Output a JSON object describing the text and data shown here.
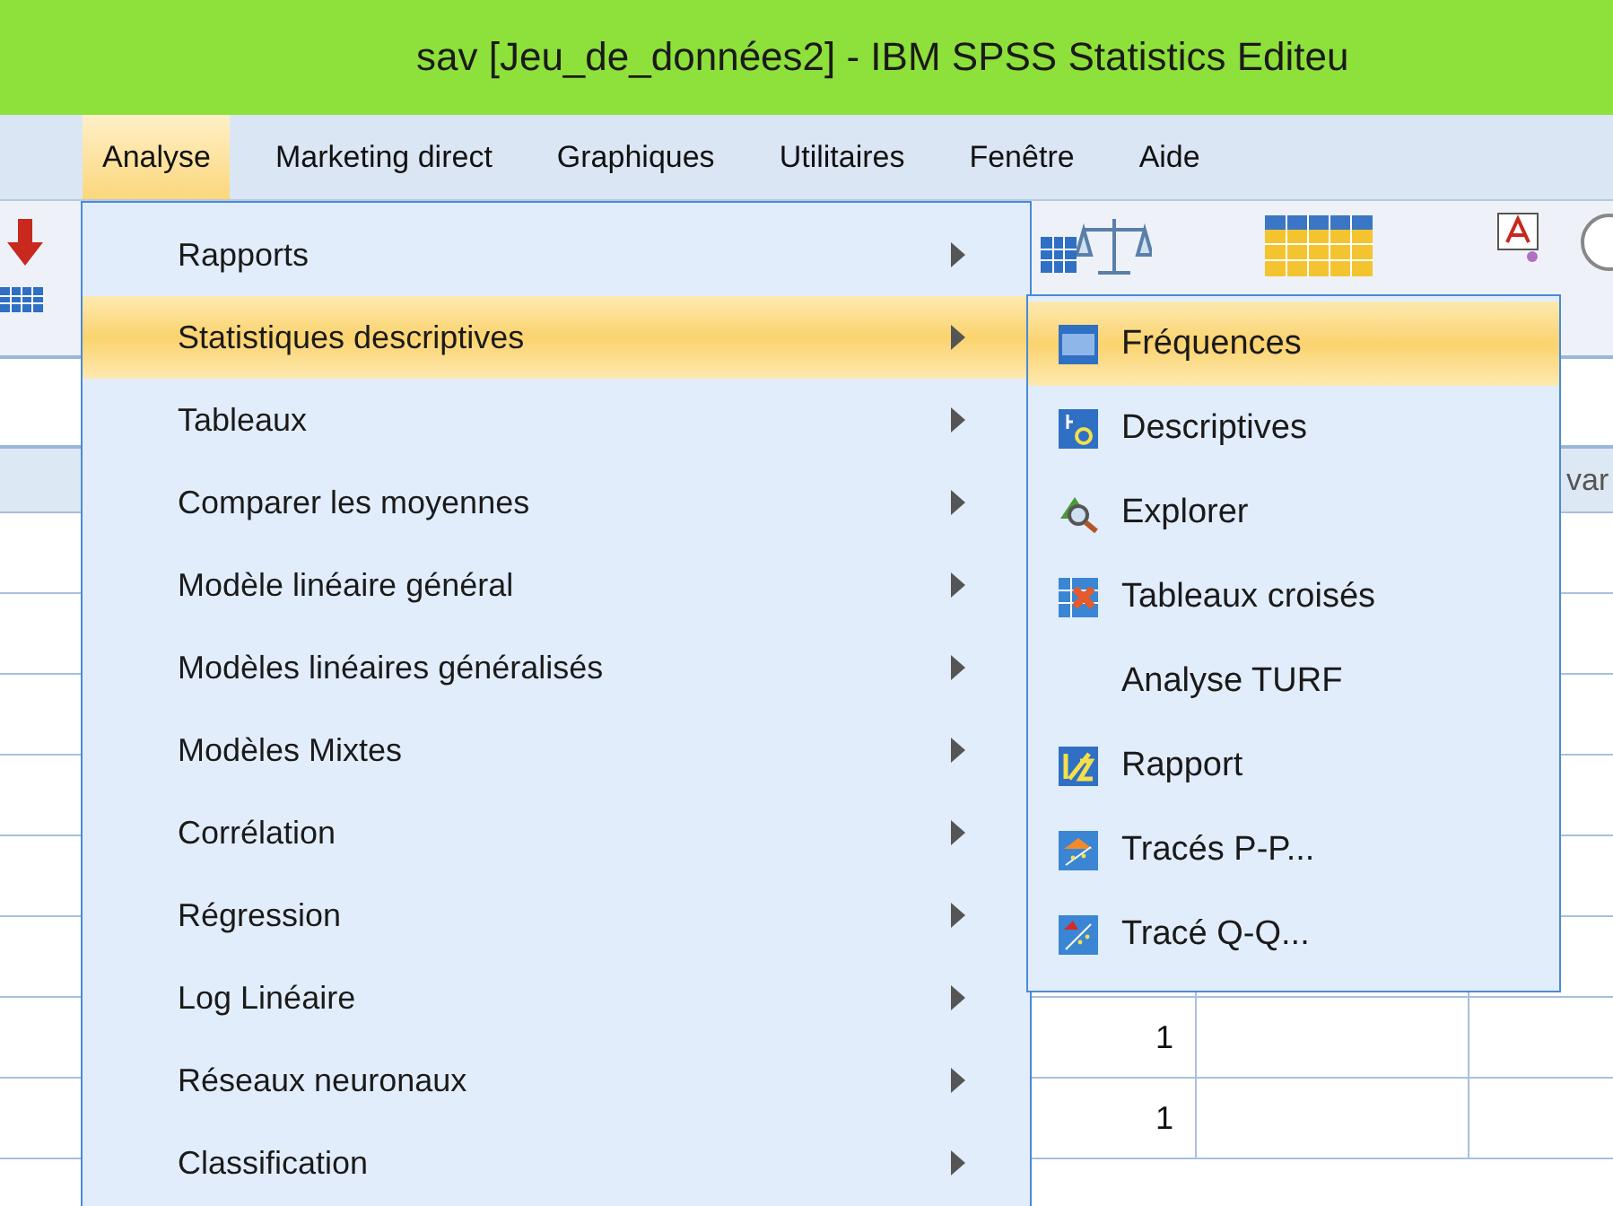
{
  "window": {
    "title": "sav [Jeu_de_données2] - IBM SPSS Statistics Editeu"
  },
  "menubar": [
    {
      "label": "Analyse",
      "selected": true
    },
    {
      "label": "Marketing direct",
      "selected": false
    },
    {
      "label": "Graphiques",
      "selected": false
    },
    {
      "label": "Utilitaires",
      "selected": false
    },
    {
      "label": "Fenêtre",
      "selected": false
    },
    {
      "label": "Aide",
      "selected": false
    }
  ],
  "menu": [
    {
      "label": "Rapports",
      "selected": false,
      "submenu": true
    },
    {
      "label": "Statistiques descriptives",
      "selected": true,
      "submenu": true
    },
    {
      "label": "Tableaux",
      "selected": false,
      "submenu": true
    },
    {
      "label": "Comparer les moyennes",
      "selected": false,
      "submenu": true
    },
    {
      "label": "Modèle linéaire général",
      "selected": false,
      "submenu": true
    },
    {
      "label": "Modèles linéaires généralisés",
      "selected": false,
      "submenu": true
    },
    {
      "label": "Modèles Mixtes",
      "selected": false,
      "submenu": true
    },
    {
      "label": "Corrélation",
      "selected": false,
      "submenu": true
    },
    {
      "label": "Régression",
      "selected": false,
      "submenu": true
    },
    {
      "label": "Log Linéaire",
      "selected": false,
      "submenu": true
    },
    {
      "label": "Réseaux neuronaux",
      "selected": false,
      "submenu": true
    },
    {
      "label": "Classification",
      "selected": false,
      "submenu": true
    }
  ],
  "submenu": [
    {
      "label": "Fréquences",
      "selected": true
    },
    {
      "label": "Descriptives",
      "selected": false
    },
    {
      "label": "Explorer",
      "selected": false
    },
    {
      "label": "Tableaux croisés",
      "selected": false
    },
    {
      "label": "Analyse TURF",
      "selected": false
    },
    {
      "label": "Rapport",
      "selected": false
    },
    {
      "label": "Tracés P-P...",
      "selected": false
    },
    {
      "label": "Tracé Q-Q...",
      "selected": false
    }
  ],
  "grid": {
    "header": "var",
    "values": [
      "1",
      "1"
    ]
  }
}
